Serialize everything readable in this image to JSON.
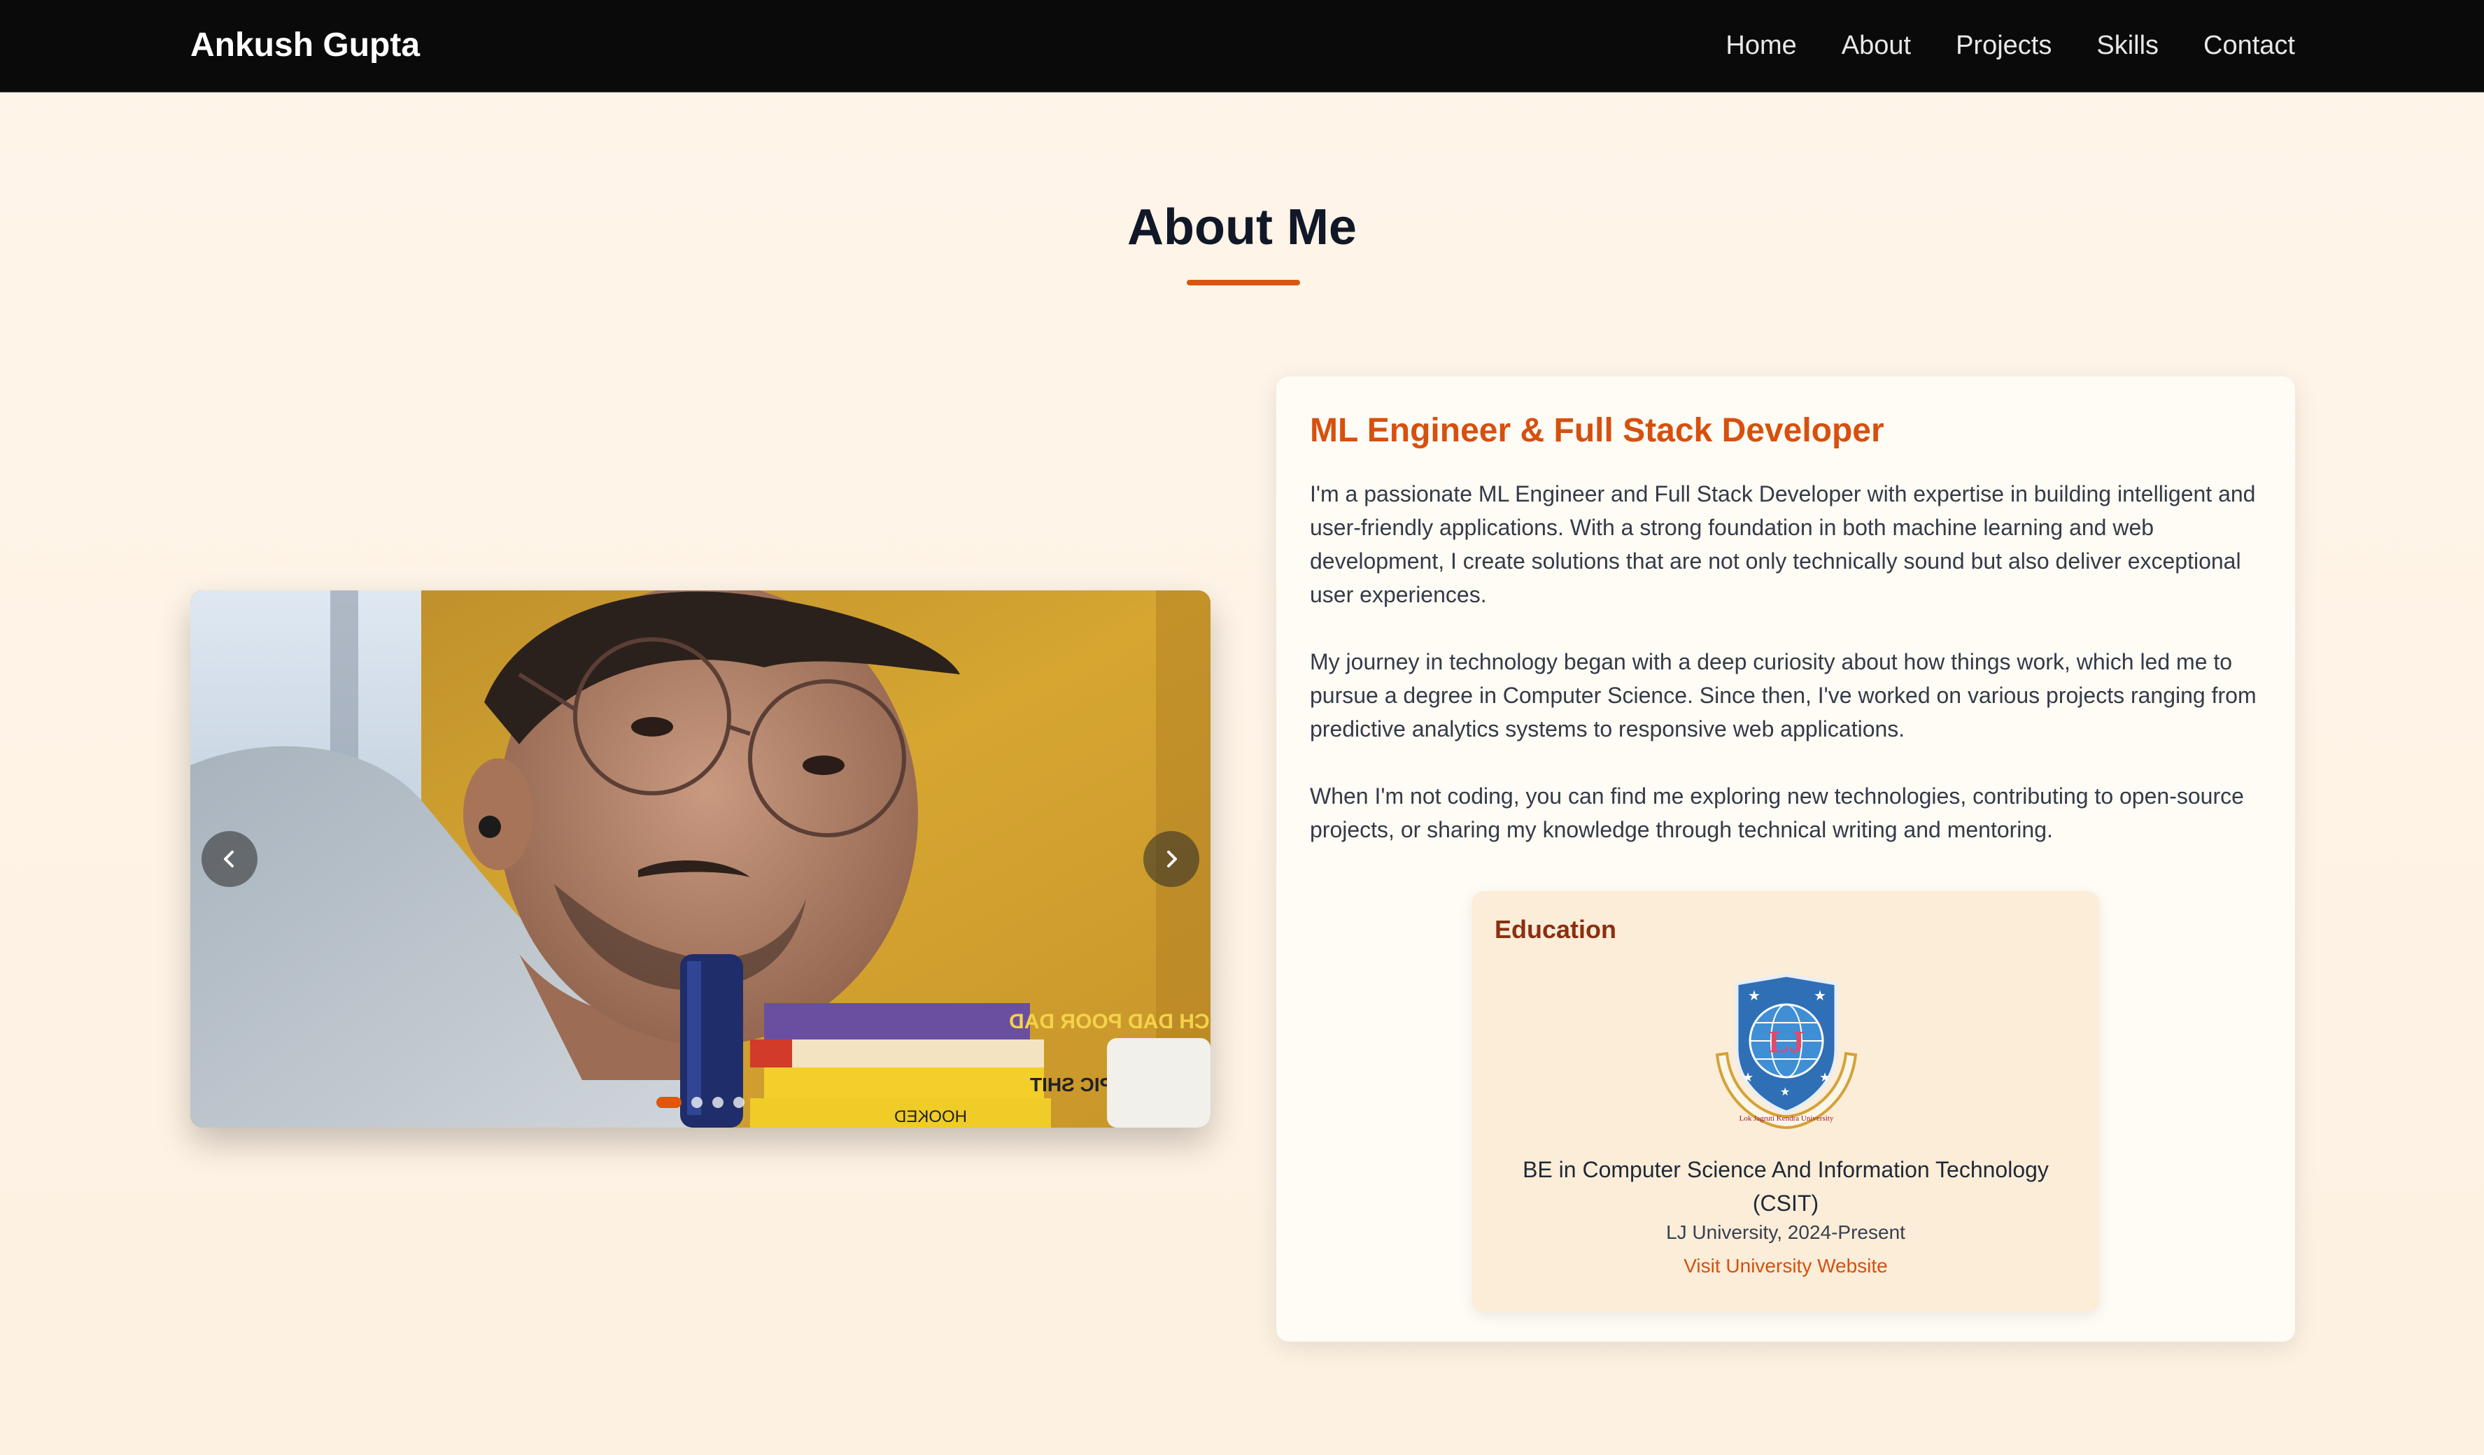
{
  "navbar": {
    "brand": "Ankush Gupta",
    "links": [
      "Home",
      "About",
      "Projects",
      "Skills",
      "Contact"
    ]
  },
  "about": {
    "title": "About Me",
    "accent_color": "#d9560f"
  },
  "carousel": {
    "prev_icon": "chevron-left-icon",
    "next_icon": "chevron-right-icon",
    "slide_count": 4,
    "active_index": 0
  },
  "card": {
    "heading": "ML Engineer & Full Stack Developer",
    "paragraphs": [
      "I'm a passionate ML Engineer and Full Stack Developer with expertise in building intelligent and user-friendly applications. With a strong foundation in both machine learning and web development, I create solutions that are not only technically sound but also deliver exceptional user experiences.",
      "My journey in technology began with a deep curiosity about how things work, which led me to pursue a degree in Computer Science. Since then, I've worked on various projects ranging from predictive analytics systems to responsive web applications.",
      "When I'm not coding, you can find me exploring new technologies, contributing to open-source projects, or sharing my knowledge through technical writing and mentoring."
    ]
  },
  "education": {
    "title": "Education",
    "logo_text": "LJ",
    "logo_caption": "Lok Jagruti Kendra University",
    "degree": "BE in Computer Science And Information Technology (CSIT)",
    "university": "LJ University, 2024-Present",
    "link_text": "Visit University Website"
  }
}
